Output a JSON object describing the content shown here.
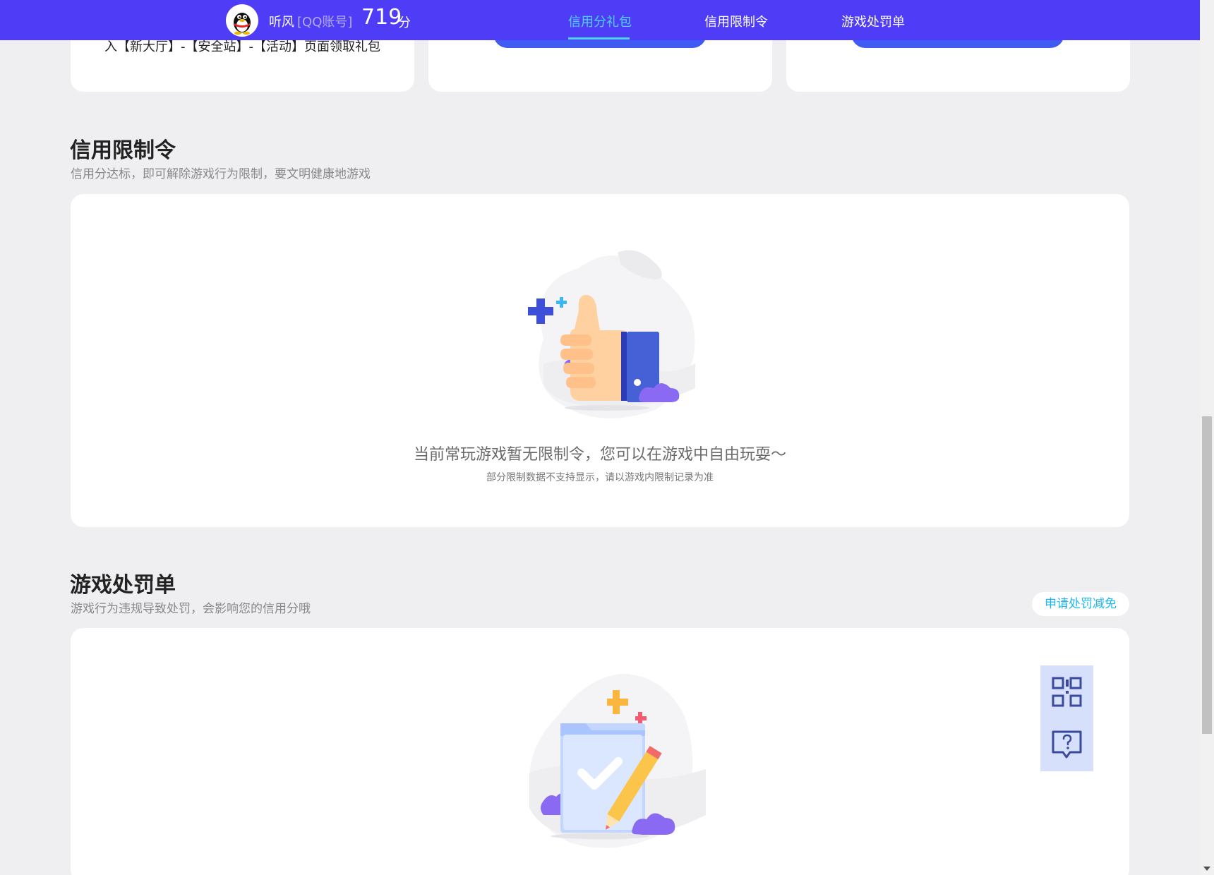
{
  "header": {
    "username": "听风",
    "account_type": "[QQ账号]",
    "score_value": "719",
    "score_unit": "分",
    "nav": [
      {
        "label": "信用分礼包",
        "active": true
      },
      {
        "label": "信用限制令",
        "active": false
      },
      {
        "label": "游戏处罚单",
        "active": false
      }
    ],
    "accent_color": "#4f3cf6",
    "active_color": "#4fd3ff"
  },
  "gift_cards": {
    "first_card_text": "入【新大厅】-【安全站】-【活动】页面领取礼包"
  },
  "restriction": {
    "title": "信用限制令",
    "subtitle": "信用分达标，即可解除游戏行为限制，要文明健康地游戏",
    "empty_message": "当前常玩游戏暂无限制令，您可以在游戏中自由玩耍～",
    "empty_note": "部分限制数据不支持显示，请以游戏内限制记录为准",
    "illustration_icon": "thumbs-up-icon"
  },
  "penalty": {
    "title": "游戏处罚单",
    "subtitle": "游戏行为违规导致处罚，会影响您的信用分哦",
    "apply_button": "申请处罚减免",
    "illustration_icon": "checklist-pencil-icon"
  },
  "float_tools": [
    {
      "icon": "qr-code-icon"
    },
    {
      "icon": "help-chat-icon"
    }
  ]
}
